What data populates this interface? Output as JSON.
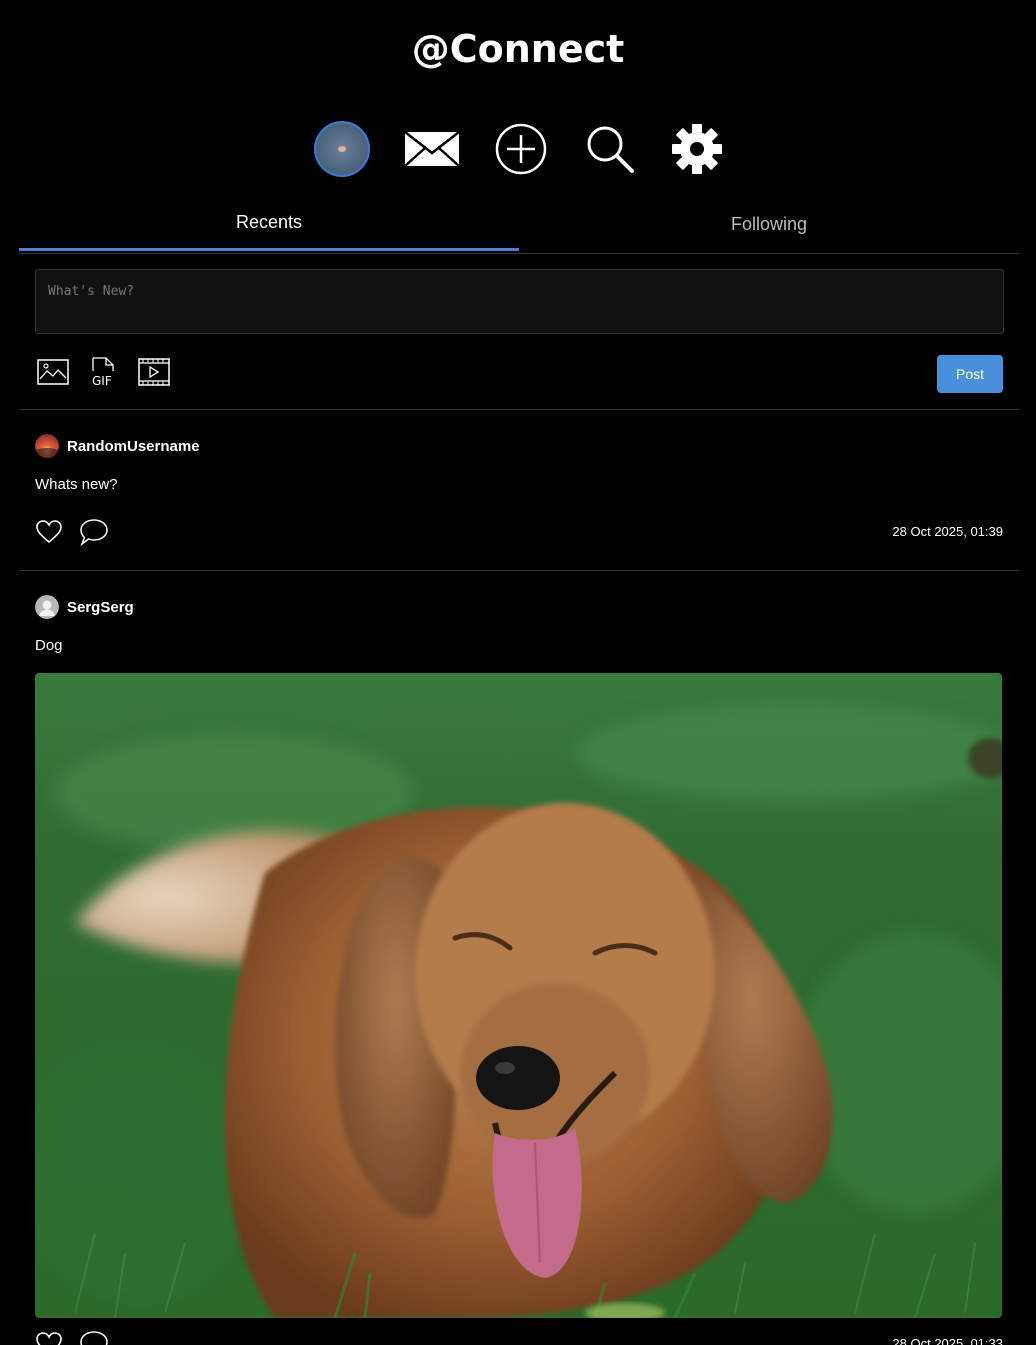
{
  "app": {
    "logo": "@Connect"
  },
  "nav": {
    "items": [
      {
        "icon": "profile-avatar-icon"
      },
      {
        "icon": "mail-icon"
      },
      {
        "icon": "plus-circle-icon"
      },
      {
        "icon": "search-icon"
      },
      {
        "icon": "gear-icon"
      }
    ]
  },
  "tabs": {
    "recents": "Recents",
    "following": "Following",
    "active": "Recents"
  },
  "composer": {
    "placeholder": "What's New?",
    "tools": [
      {
        "icon": "image-icon"
      },
      {
        "icon": "gif-icon",
        "label": "GIF"
      },
      {
        "icon": "video-icon"
      }
    ],
    "post_label": "Post"
  },
  "posts": [
    {
      "username": "RandomUsername",
      "text": "Whats new?",
      "timestamp": "28 Oct 2025, 01:39",
      "has_image": false
    },
    {
      "username": "SergSerg",
      "text": "Dog",
      "timestamp": "28 Oct 2025, 01:33",
      "has_image": true,
      "image_subject": "dog"
    }
  ],
  "colors": {
    "accent": "#4a8fdb",
    "tab_underline": "#4a7fd4",
    "background": "#000000"
  }
}
